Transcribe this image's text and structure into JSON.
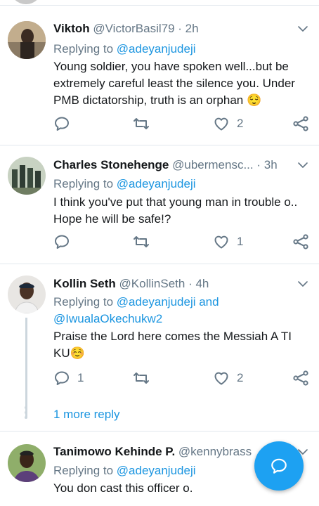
{
  "tweets": [
    {
      "name": "Viktoh",
      "handle": "@VictorBasil79",
      "time": "· 2h",
      "replying_prefix": "Replying to ",
      "replying_to": "@adeyanjudeji",
      "text": "Young soldier, you have spoken well...but be extremely careful least the silence you. Under PMB dictatorship, truth is an orphan 😌",
      "reply_count": "",
      "like_count": "2"
    },
    {
      "name": "Charles Stonehenge",
      "handle": "@ubermensc...",
      "time": "· 3h",
      "replying_prefix": "Replying to ",
      "replying_to": "@adeyanjudeji",
      "text": "I think you've put that young man in trouble o.. Hope he will be safe!?",
      "reply_count": "",
      "like_count": "1"
    },
    {
      "name": "Kollin Seth",
      "handle": "@KollinSeth",
      "time": "· 4h",
      "replying_prefix": "Replying to ",
      "replying_to": "@adeyanjudeji and",
      "replying_to_2": "@IwualaOkechukw2",
      "text": "Praise the Lord here comes the Messiah A TI KU☺️",
      "reply_count": "1",
      "like_count": "2",
      "more_replies": "1 more reply"
    },
    {
      "name": "Tanimowo Kehinde P.",
      "handle": "@kennybrass",
      "time": "· ",
      "replying_prefix": "Replying to ",
      "replying_to": "@adeyanjudeji",
      "text": "You don cast this officer o."
    }
  ],
  "icons": {
    "reply": "reply-icon",
    "retweet": "retweet-icon",
    "like": "heart-icon",
    "share": "share-icon",
    "caret": "chevron-down-icon",
    "compose": "compose-reply-icon"
  },
  "colors": {
    "accent": "#1da1f2",
    "link": "#1b95e0",
    "muted": "#657786"
  }
}
